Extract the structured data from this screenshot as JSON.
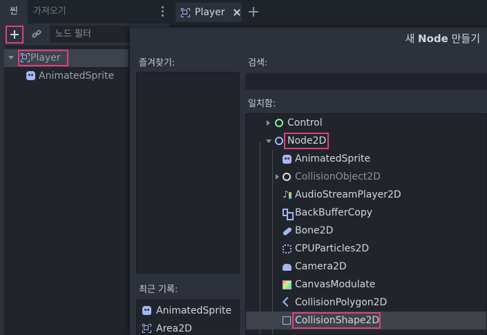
{
  "scene_dock": {
    "tab_scene": "씬",
    "tab_import": "가져오기",
    "filter_placeholder": "노드 필터",
    "tree": [
      {
        "label": "Player"
      },
      {
        "label": "AnimatedSprite"
      }
    ]
  },
  "editor": {
    "tab_label": "Player"
  },
  "dialog": {
    "title_prefix": "새 ",
    "title_bold": "Node",
    "title_suffix": " 만들기",
    "favorites_label": "즐겨찾기:",
    "recent_label": "최근 기록:",
    "recent_items": [
      {
        "label": "AnimatedSprite",
        "icon": "animated-sprite-icon"
      },
      {
        "label": "Area2D",
        "icon": "area2d-icon"
      }
    ],
    "search_label": "검색:",
    "search_value": "",
    "matches_label": "일치함:",
    "nodes": [
      {
        "label": "Control",
        "icon": "control-icon"
      },
      {
        "label": "Node2D",
        "icon": "node2d-icon"
      },
      {
        "label": "AnimatedSprite",
        "icon": "animated-sprite-icon"
      },
      {
        "label": "CollisionObject2D",
        "icon": "collision-object-icon"
      },
      {
        "label": "AudioStreamPlayer2D",
        "icon": "audio-stream-player-icon"
      },
      {
        "label": "BackBufferCopy",
        "icon": "back-buffer-copy-icon"
      },
      {
        "label": "Bone2D",
        "icon": "bone-icon"
      },
      {
        "label": "CPUParticles2D",
        "icon": "cpu-particles-icon"
      },
      {
        "label": "Camera2D",
        "icon": "camera-icon"
      },
      {
        "label": "CanvasModulate",
        "icon": "canvas-modulate-icon"
      },
      {
        "label": "CollisionPolygon2D",
        "icon": "collision-polygon-icon"
      },
      {
        "label": "CollisionShape2D",
        "icon": "collision-shape-icon"
      }
    ]
  },
  "colors": {
    "highlight": "#e0407b",
    "node2d_blue": "#a5b7f3",
    "control_green": "#8eef97"
  }
}
